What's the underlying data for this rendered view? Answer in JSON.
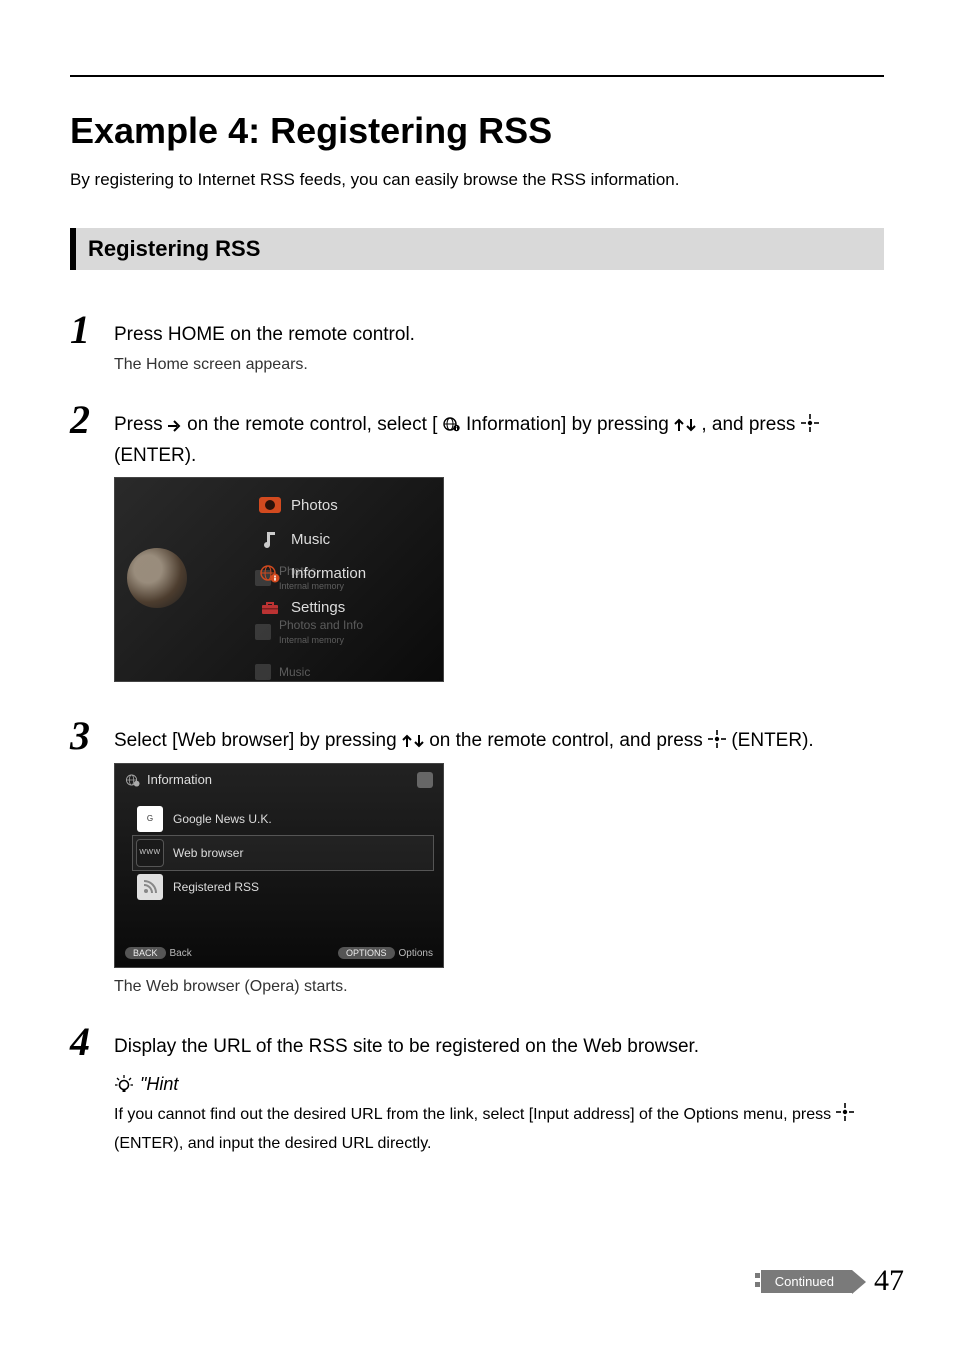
{
  "title": "Example 4: Registering RSS",
  "intro": "By registering to Internet RSS feeds, you can easily browse the RSS information.",
  "subheader": "Registering RSS",
  "steps": {
    "s1": {
      "num": "1",
      "main": "Press HOME on the remote control.",
      "sub": "The Home screen appears."
    },
    "s2": {
      "num": "2",
      "main_a": "Press ",
      "main_b": " on the remote control, select [",
      "main_c": " Information] by pressing ",
      "main_d": ", and press ",
      "main_e": " (ENTER)."
    },
    "s3": {
      "num": "3",
      "main_a": "Select [Web browser] by pressing ",
      "main_b": " on the remote control, and press ",
      "main_c": " (ENTER).",
      "sub": "The Web browser (Opera) starts."
    },
    "s4": {
      "num": "4",
      "main": "Display the URL of the RSS site to be registered on the Web browser.",
      "hint_label": "\"Hint",
      "hint_a": "If you cannot find out the desired URL from the link, select [Input address] of the Options menu, press ",
      "hint_b": " (ENTER), and input the desired URL directly."
    }
  },
  "shot1": {
    "bg_photos": "Photos",
    "bg_internal": "Internal memory",
    "bg_photos_info": "Photos and Info",
    "bg_internal2": "Internal memory",
    "bg_music": "Music",
    "menu": {
      "photos": "Photos",
      "music": "Music",
      "information": "Information",
      "settings": "Settings"
    }
  },
  "shot2": {
    "header": "Information",
    "items": {
      "google": "Google News U.K.",
      "www_label": "WWW",
      "web": "Web browser",
      "rss": "Registered RSS"
    },
    "footer": {
      "back_pill": "BACK",
      "back": "Back",
      "options_pill": "OPTIONS",
      "options": "Options"
    }
  },
  "footer": {
    "continued": "Continued",
    "page": "47"
  }
}
